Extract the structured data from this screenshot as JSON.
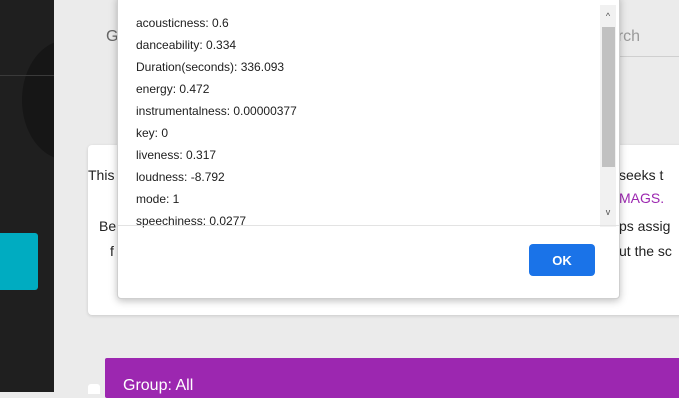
{
  "header": {
    "tab_fragment": "G",
    "search_placeholder_fragment": "earch"
  },
  "card": {
    "line1_left": "This",
    "line1_right": "seeks t",
    "line2_right": "MAGS.",
    "line3_left": "Be",
    "line3_right": "ps assig",
    "line4_left": "f",
    "line4_right": "ut the sc"
  },
  "group_bar": {
    "label": "Group: All"
  },
  "dialog": {
    "lines": [
      "acousticness: 0.6",
      "danceability: 0.334",
      "Duration(seconds): 336.093",
      "energy: 0.472",
      "instrumentalness: 0.00000377",
      "key: 0",
      "liveness: 0.317",
      "loudness: -8.792",
      "mode: 1",
      "speechiness: 0.0277"
    ],
    "ok_label": "OK",
    "scroll_up_glyph": "^",
    "scroll_down_glyph": "v"
  },
  "colors": {
    "accent_purple": "#9c27b0",
    "teal": "#00acc1",
    "ok_blue": "#1a73e8"
  }
}
